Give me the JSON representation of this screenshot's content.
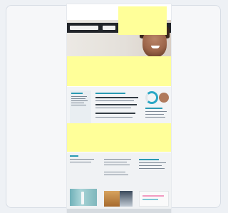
{
  "page": {
    "logo_line1": "",
    "logo_line2": ""
  },
  "colors": {
    "accent": "#2a9ab3",
    "redaction": "#ffff99",
    "header_bar": "#22252a"
  }
}
